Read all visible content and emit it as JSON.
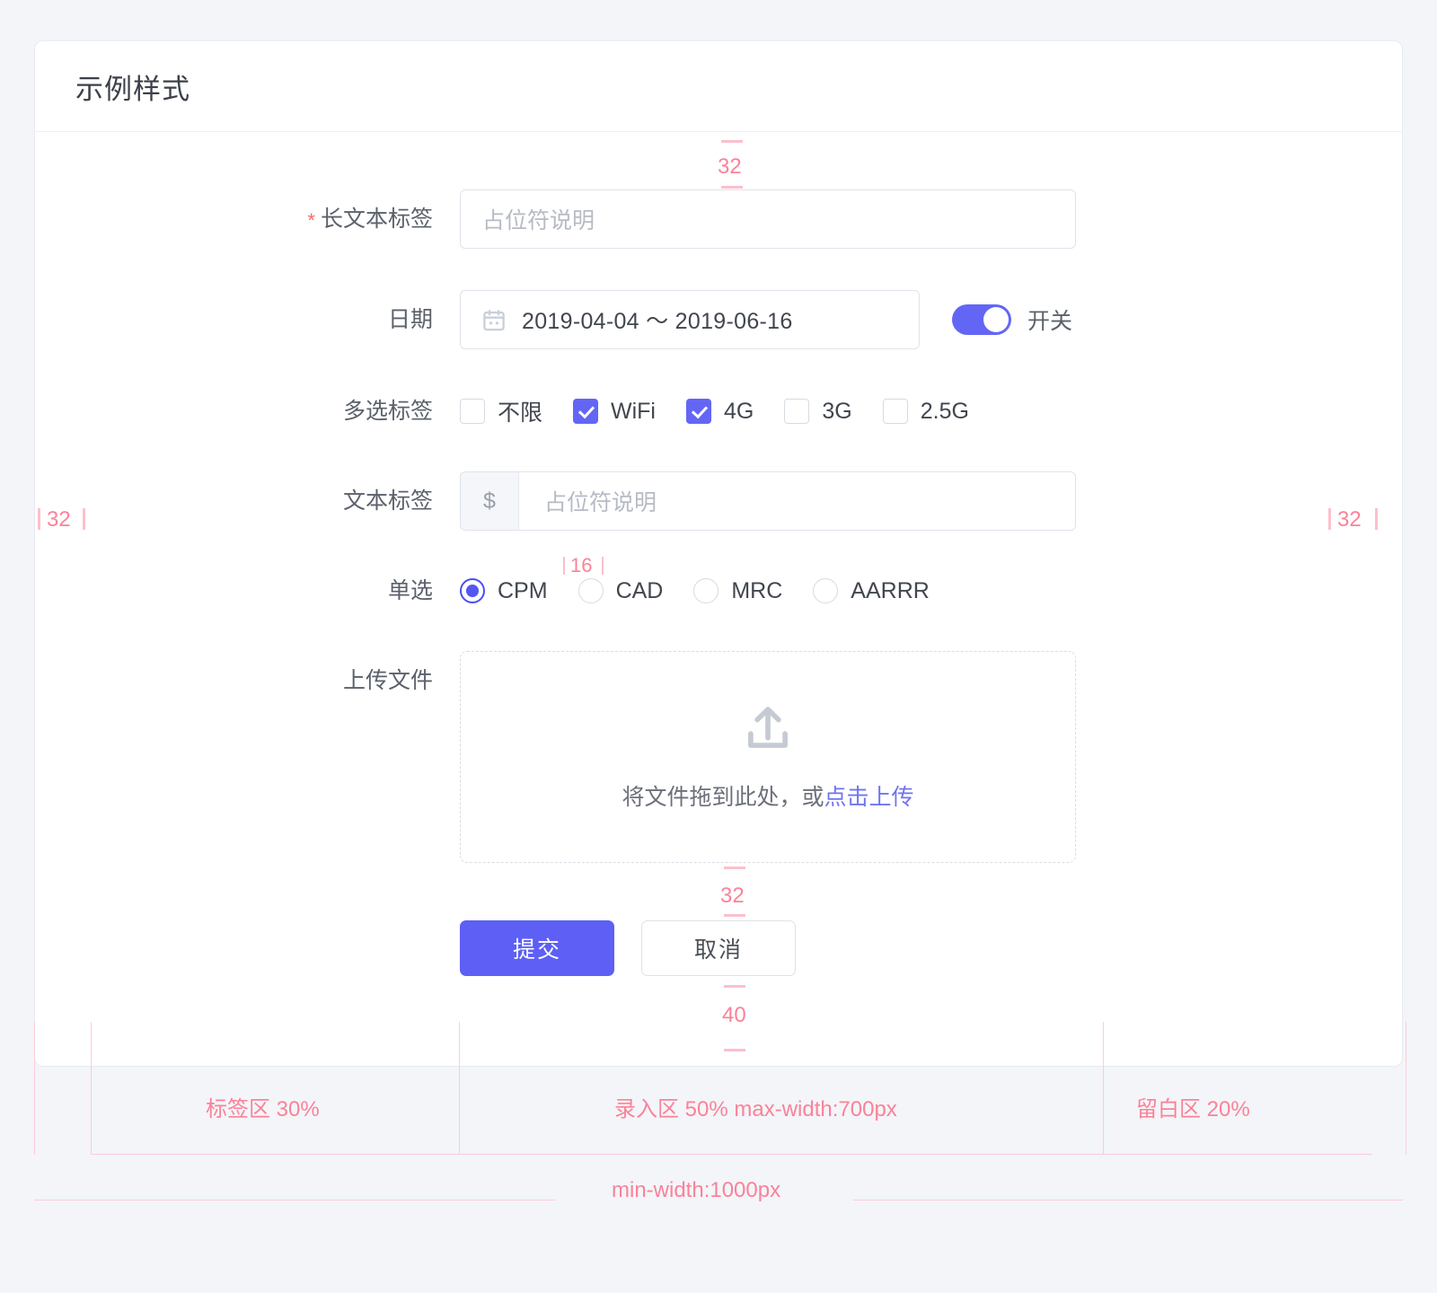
{
  "page": {
    "title": "示例样式",
    "background": "#f3f5f9",
    "accent": "#5d5ff5",
    "anno_color": "#fb8298"
  },
  "form": {
    "long_text": {
      "label": "长文本标签",
      "required_mark": "*",
      "placeholder": "占位符说明",
      "value": ""
    },
    "date": {
      "label": "日期",
      "icon": "calendar-icon",
      "value": "2019-04-04 ～ 2019-06-16",
      "switch_label": "开关",
      "switch_on": true
    },
    "checkbox_group": {
      "label": "多选标签",
      "options": [
        {
          "label": "不限",
          "checked": false
        },
        {
          "label": "WiFi",
          "checked": true
        },
        {
          "label": "4G",
          "checked": true
        },
        {
          "label": "3G",
          "checked": false
        },
        {
          "label": "2.5G",
          "checked": false
        }
      ]
    },
    "text_field": {
      "label": "文本标签",
      "prefix": "$",
      "placeholder": "占位符说明",
      "value": ""
    },
    "radio_group": {
      "label": "单选",
      "options": [
        {
          "label": "CPM",
          "selected": true
        },
        {
          "label": "CAD",
          "selected": false
        },
        {
          "label": "MRC",
          "selected": false
        },
        {
          "label": "AARRR",
          "selected": false
        }
      ],
      "spacing_annotation": "16"
    },
    "upload": {
      "label": "上传文件",
      "icon": "upload-icon",
      "hint_prefix": "将文件拖到此处，或",
      "hint_link": "点击上传"
    },
    "actions": {
      "submit": "提交",
      "cancel": "取消"
    }
  },
  "annotations": {
    "top_gap": "32",
    "left_gap": "32",
    "right_gap": "32",
    "button_gap_above": "32",
    "bottom_gap": "40",
    "zones": [
      {
        "text": "标签区 30%"
      },
      {
        "text": "录入区 50% max-width:700px"
      },
      {
        "text": "留白区 20%"
      }
    ],
    "min_width": "min-width:1000px"
  }
}
